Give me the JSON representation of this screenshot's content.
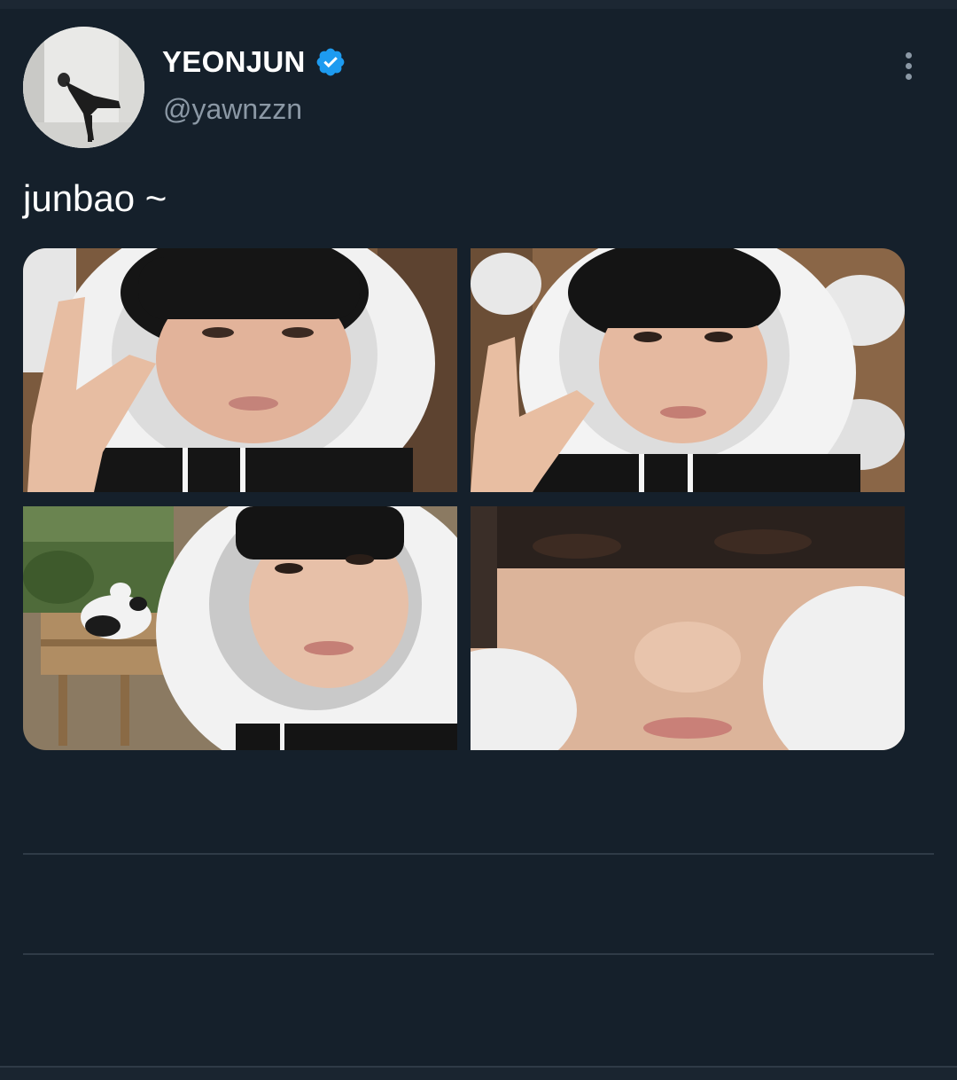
{
  "author": {
    "display_name": "YEONJUN",
    "handle": "@yawnzzn",
    "verified": true,
    "avatar_icon": "profile-photo"
  },
  "tweet": {
    "text": "junbao ~",
    "media": [
      {
        "name": "photo-peace-sign-panda-hood-1"
      },
      {
        "name": "photo-peace-sign-panda-hood-2"
      },
      {
        "name": "photo-selfie-with-panda"
      },
      {
        "name": "photo-closeup-face"
      }
    ]
  },
  "icons": {
    "verified": "verified-badge-icon",
    "more": "more-options-icon"
  },
  "colors": {
    "background": "#15202b",
    "secondary_text": "#8b98a5",
    "verified_blue": "#1d9bf0",
    "divider": "#2f3b47"
  }
}
